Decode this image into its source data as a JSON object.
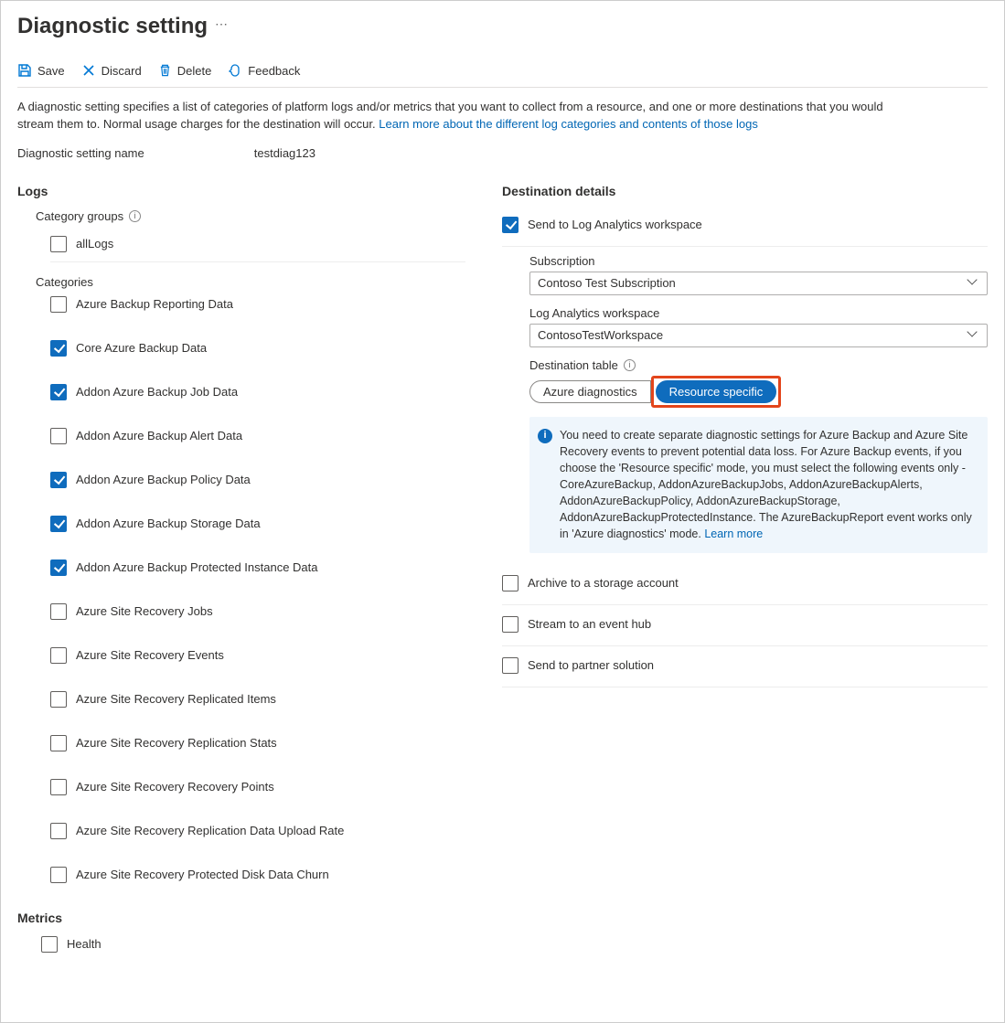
{
  "title": "Diagnostic setting",
  "toolbar": {
    "save": "Save",
    "discard": "Discard",
    "delete": "Delete",
    "feedback": "Feedback"
  },
  "description_text": "A diagnostic setting specifies a list of categories of platform logs and/or metrics that you want to collect from a resource, and one or more destinations that you would stream them to. Normal usage charges for the destination will occur. ",
  "description_link": "Learn more about the different log categories and contents of those logs",
  "setting_name_label": "Diagnostic setting name",
  "setting_name_value": "testdiag123",
  "logs": {
    "heading": "Logs",
    "category_groups_label": "Category groups",
    "all_logs": {
      "label": "allLogs",
      "checked": false
    },
    "categories_label": "Categories",
    "categories": [
      {
        "label": "Azure Backup Reporting Data",
        "checked": false
      },
      {
        "label": "Core Azure Backup Data",
        "checked": true
      },
      {
        "label": "Addon Azure Backup Job Data",
        "checked": true
      },
      {
        "label": "Addon Azure Backup Alert Data",
        "checked": false
      },
      {
        "label": "Addon Azure Backup Policy Data",
        "checked": true
      },
      {
        "label": "Addon Azure Backup Storage Data",
        "checked": true
      },
      {
        "label": "Addon Azure Backup Protected Instance Data",
        "checked": true
      },
      {
        "label": "Azure Site Recovery Jobs",
        "checked": false
      },
      {
        "label": "Azure Site Recovery Events",
        "checked": false
      },
      {
        "label": "Azure Site Recovery Replicated Items",
        "checked": false
      },
      {
        "label": "Azure Site Recovery Replication Stats",
        "checked": false
      },
      {
        "label": "Azure Site Recovery Recovery Points",
        "checked": false
      },
      {
        "label": "Azure Site Recovery Replication Data Upload Rate",
        "checked": false
      },
      {
        "label": "Azure Site Recovery Protected Disk Data Churn",
        "checked": false
      }
    ]
  },
  "metrics": {
    "heading": "Metrics",
    "items": [
      {
        "label": "Health",
        "checked": false
      }
    ]
  },
  "destination": {
    "heading": "Destination details",
    "send_to_law": {
      "label": "Send to Log Analytics workspace",
      "checked": true
    },
    "subscription_label": "Subscription",
    "subscription_value": "Contoso Test Subscription",
    "workspace_label": "Log Analytics workspace",
    "workspace_value": "ContosoTestWorkspace",
    "dest_table_label": "Destination table",
    "toggle": {
      "azure_diag": "Azure diagnostics",
      "resource_specific": "Resource specific",
      "active": "resource_specific"
    },
    "info_text": "You need to create separate diagnostic settings for Azure Backup and Azure Site Recovery events to prevent potential data loss. For Azure Backup events, if you choose the 'Resource specific' mode, you must select the following events only - CoreAzureBackup, AddonAzureBackupJobs, AddonAzureBackupAlerts, AddonAzureBackupPolicy, AddonAzureBackupStorage, AddonAzureBackupProtectedInstance. The AzureBackupReport event works only in 'Azure diagnostics' mode.  ",
    "info_link": "Learn more",
    "other": [
      {
        "label": "Archive to a storage account",
        "checked": false
      },
      {
        "label": "Stream to an event hub",
        "checked": false
      },
      {
        "label": "Send to partner solution",
        "checked": false
      }
    ]
  }
}
